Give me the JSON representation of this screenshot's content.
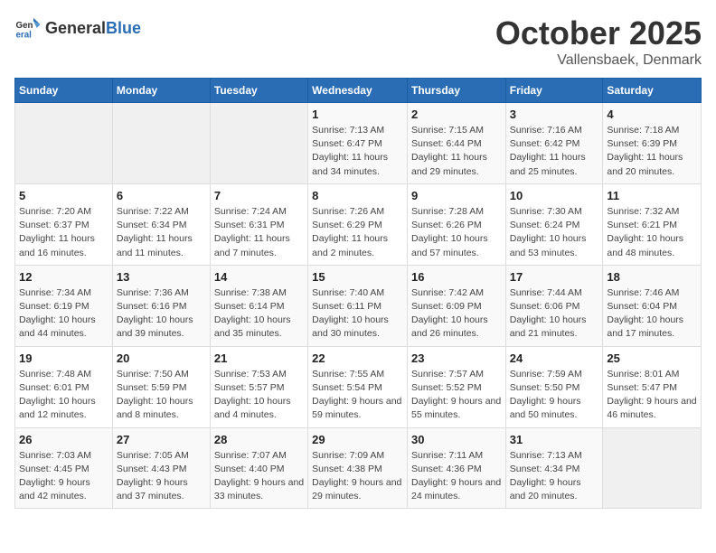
{
  "header": {
    "logo_general": "General",
    "logo_blue": "Blue",
    "month": "October 2025",
    "location": "Vallensbaek, Denmark"
  },
  "weekdays": [
    "Sunday",
    "Monday",
    "Tuesday",
    "Wednesday",
    "Thursday",
    "Friday",
    "Saturday"
  ],
  "weeks": [
    [
      {
        "day": "",
        "info": ""
      },
      {
        "day": "",
        "info": ""
      },
      {
        "day": "",
        "info": ""
      },
      {
        "day": "1",
        "info": "Sunrise: 7:13 AM\nSunset: 6:47 PM\nDaylight: 11 hours and 34 minutes."
      },
      {
        "day": "2",
        "info": "Sunrise: 7:15 AM\nSunset: 6:44 PM\nDaylight: 11 hours and 29 minutes."
      },
      {
        "day": "3",
        "info": "Sunrise: 7:16 AM\nSunset: 6:42 PM\nDaylight: 11 hours and 25 minutes."
      },
      {
        "day": "4",
        "info": "Sunrise: 7:18 AM\nSunset: 6:39 PM\nDaylight: 11 hours and 20 minutes."
      }
    ],
    [
      {
        "day": "5",
        "info": "Sunrise: 7:20 AM\nSunset: 6:37 PM\nDaylight: 11 hours and 16 minutes."
      },
      {
        "day": "6",
        "info": "Sunrise: 7:22 AM\nSunset: 6:34 PM\nDaylight: 11 hours and 11 minutes."
      },
      {
        "day": "7",
        "info": "Sunrise: 7:24 AM\nSunset: 6:31 PM\nDaylight: 11 hours and 7 minutes."
      },
      {
        "day": "8",
        "info": "Sunrise: 7:26 AM\nSunset: 6:29 PM\nDaylight: 11 hours and 2 minutes."
      },
      {
        "day": "9",
        "info": "Sunrise: 7:28 AM\nSunset: 6:26 PM\nDaylight: 10 hours and 57 minutes."
      },
      {
        "day": "10",
        "info": "Sunrise: 7:30 AM\nSunset: 6:24 PM\nDaylight: 10 hours and 53 minutes."
      },
      {
        "day": "11",
        "info": "Sunrise: 7:32 AM\nSunset: 6:21 PM\nDaylight: 10 hours and 48 minutes."
      }
    ],
    [
      {
        "day": "12",
        "info": "Sunrise: 7:34 AM\nSunset: 6:19 PM\nDaylight: 10 hours and 44 minutes."
      },
      {
        "day": "13",
        "info": "Sunrise: 7:36 AM\nSunset: 6:16 PM\nDaylight: 10 hours and 39 minutes."
      },
      {
        "day": "14",
        "info": "Sunrise: 7:38 AM\nSunset: 6:14 PM\nDaylight: 10 hours and 35 minutes."
      },
      {
        "day": "15",
        "info": "Sunrise: 7:40 AM\nSunset: 6:11 PM\nDaylight: 10 hours and 30 minutes."
      },
      {
        "day": "16",
        "info": "Sunrise: 7:42 AM\nSunset: 6:09 PM\nDaylight: 10 hours and 26 minutes."
      },
      {
        "day": "17",
        "info": "Sunrise: 7:44 AM\nSunset: 6:06 PM\nDaylight: 10 hours and 21 minutes."
      },
      {
        "day": "18",
        "info": "Sunrise: 7:46 AM\nSunset: 6:04 PM\nDaylight: 10 hours and 17 minutes."
      }
    ],
    [
      {
        "day": "19",
        "info": "Sunrise: 7:48 AM\nSunset: 6:01 PM\nDaylight: 10 hours and 12 minutes."
      },
      {
        "day": "20",
        "info": "Sunrise: 7:50 AM\nSunset: 5:59 PM\nDaylight: 10 hours and 8 minutes."
      },
      {
        "day": "21",
        "info": "Sunrise: 7:53 AM\nSunset: 5:57 PM\nDaylight: 10 hours and 4 minutes."
      },
      {
        "day": "22",
        "info": "Sunrise: 7:55 AM\nSunset: 5:54 PM\nDaylight: 9 hours and 59 minutes."
      },
      {
        "day": "23",
        "info": "Sunrise: 7:57 AM\nSunset: 5:52 PM\nDaylight: 9 hours and 55 minutes."
      },
      {
        "day": "24",
        "info": "Sunrise: 7:59 AM\nSunset: 5:50 PM\nDaylight: 9 hours and 50 minutes."
      },
      {
        "day": "25",
        "info": "Sunrise: 8:01 AM\nSunset: 5:47 PM\nDaylight: 9 hours and 46 minutes."
      }
    ],
    [
      {
        "day": "26",
        "info": "Sunrise: 7:03 AM\nSunset: 4:45 PM\nDaylight: 9 hours and 42 minutes."
      },
      {
        "day": "27",
        "info": "Sunrise: 7:05 AM\nSunset: 4:43 PM\nDaylight: 9 hours and 37 minutes."
      },
      {
        "day": "28",
        "info": "Sunrise: 7:07 AM\nSunset: 4:40 PM\nDaylight: 9 hours and 33 minutes."
      },
      {
        "day": "29",
        "info": "Sunrise: 7:09 AM\nSunset: 4:38 PM\nDaylight: 9 hours and 29 minutes."
      },
      {
        "day": "30",
        "info": "Sunrise: 7:11 AM\nSunset: 4:36 PM\nDaylight: 9 hours and 24 minutes."
      },
      {
        "day": "31",
        "info": "Sunrise: 7:13 AM\nSunset: 4:34 PM\nDaylight: 9 hours and 20 minutes."
      },
      {
        "day": "",
        "info": ""
      }
    ]
  ]
}
